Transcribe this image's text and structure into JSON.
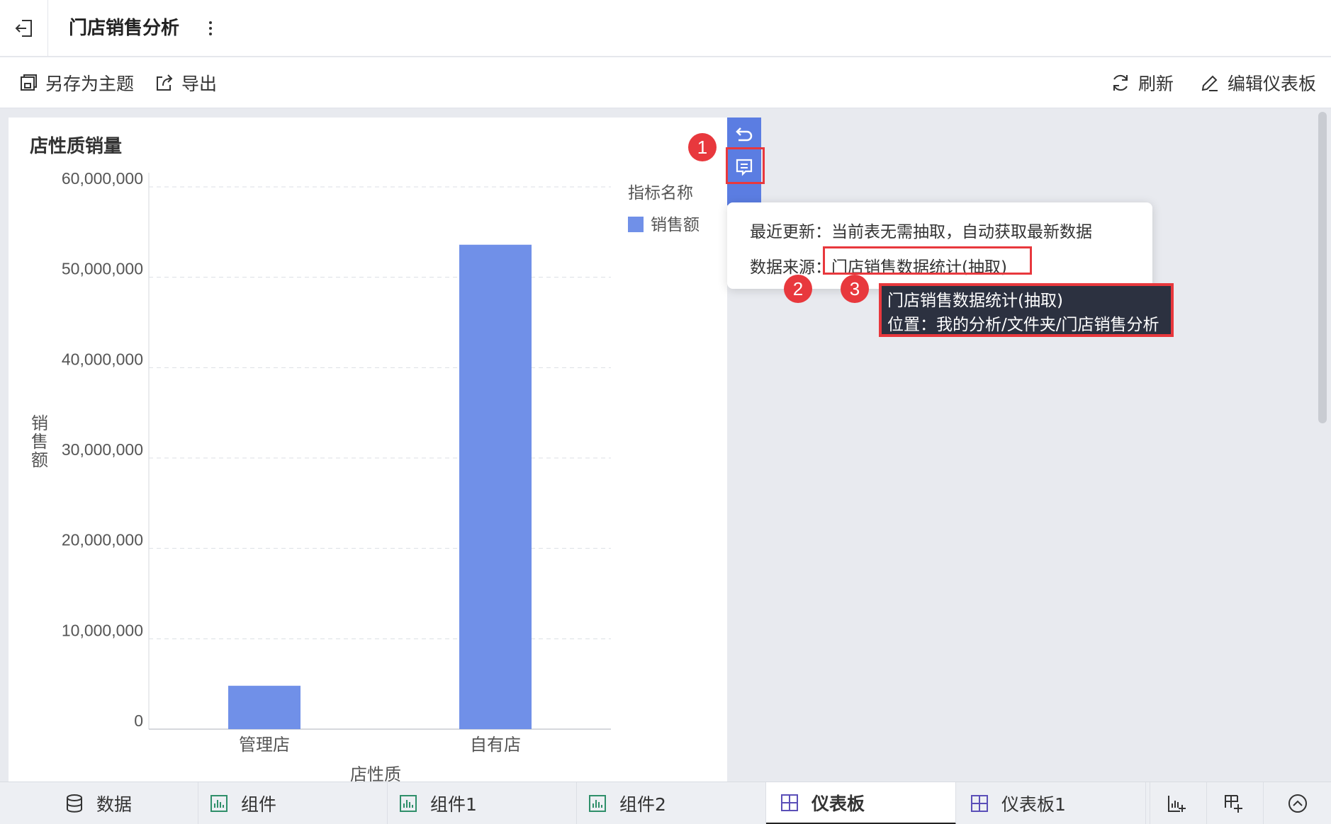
{
  "header": {
    "title": "门店销售分析"
  },
  "toolbar": {
    "save_as_theme": "另存为主题",
    "export": "导出",
    "refresh": "刷新",
    "edit_dashboard": "编辑仪表板"
  },
  "card": {
    "title": "店性质销量"
  },
  "chart_data": {
    "type": "bar",
    "title": "店性质销量",
    "categories": [
      "管理店",
      "自有店"
    ],
    "series": [
      {
        "name": "销售额",
        "values": [
          4800000,
          53600000
        ],
        "color": "#7090e8"
      }
    ],
    "xlabel": "店性质",
    "ylabel": "销售额",
    "ylim": [
      0,
      60000000
    ],
    "yticks": [
      "60,000,000",
      "50,000,000",
      "40,000,000",
      "30,000,000",
      "20,000,000",
      "10,000,000",
      "0"
    ],
    "ytick_values": [
      60000000,
      50000000,
      40000000,
      30000000,
      20000000,
      10000000,
      0
    ],
    "legend_title": "指标名称",
    "legend_position": "top-right",
    "grid": true
  },
  "popover": {
    "last_update_label": "最近更新：",
    "last_update_value": "当前表无需抽取，自动获取最新数据",
    "source_label": "数据来源：",
    "source_value": "门店销售数据统计(抽取)"
  },
  "tooltip": {
    "line1": "门店销售数据统计(抽取)",
    "line2": "位置：我的分析/文件夹/门店销售分析"
  },
  "badges": [
    "1",
    "2",
    "3"
  ],
  "tabs": [
    {
      "label": "数据",
      "icon": "database-icon"
    },
    {
      "label": "组件",
      "icon": "chart-icon"
    },
    {
      "label": "组件1",
      "icon": "chart-icon"
    },
    {
      "label": "组件2",
      "icon": "chart-icon"
    },
    {
      "label": "仪表板",
      "icon": "dashboard-icon",
      "active": true
    },
    {
      "label": "仪表板1",
      "icon": "dashboard-icon"
    }
  ],
  "colors": {
    "accent": "#5b7de2",
    "bar": "#7090e8",
    "highlight": "#e8383d",
    "tooltip_bg": "#2c3140"
  }
}
